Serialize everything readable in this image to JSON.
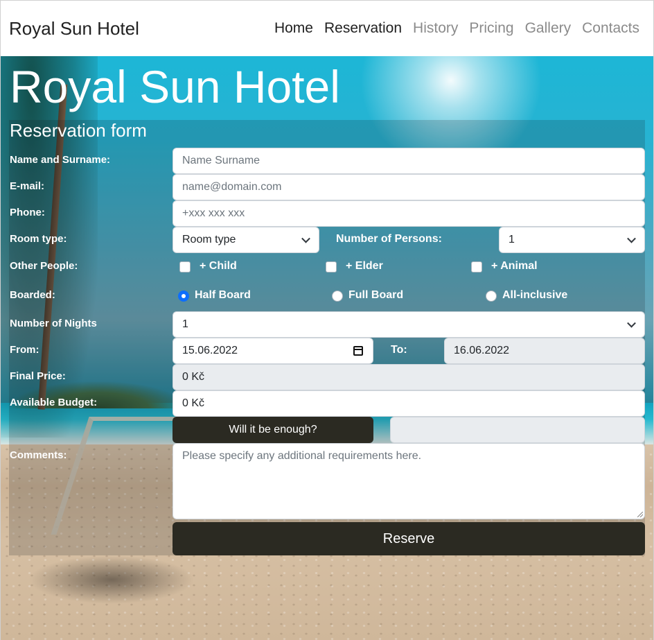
{
  "navbar": {
    "brand": "Royal Sun Hotel",
    "links": [
      {
        "label": "Home",
        "active": true
      },
      {
        "label": "Reservation",
        "active": true
      },
      {
        "label": "History",
        "active": false
      },
      {
        "label": "Pricing",
        "active": false
      },
      {
        "label": "Gallery",
        "active": false
      },
      {
        "label": "Contacts",
        "active": false
      }
    ]
  },
  "hero": {
    "title": "Royal Sun Hotel"
  },
  "form": {
    "title": "Reservation form",
    "name": {
      "label": "Name and Surname:",
      "placeholder": "Name Surname"
    },
    "email": {
      "label": "E-mail:",
      "placeholder": "name@domain.com"
    },
    "phone": {
      "label": "Phone:",
      "placeholder": "+xxx xxx xxx"
    },
    "room_type": {
      "label": "Room type:",
      "value": "Room type"
    },
    "persons": {
      "label": "Number of Persons:",
      "value": "1"
    },
    "other_people": {
      "label": "Other People:",
      "options": [
        {
          "label": "+ Child",
          "checked": false
        },
        {
          "label": "+ Elder",
          "checked": false
        },
        {
          "label": "+ Animal",
          "checked": false
        }
      ]
    },
    "boarded": {
      "label": "Boarded:",
      "options": [
        {
          "label": "Half Board",
          "selected": true
        },
        {
          "label": "Full Board",
          "selected": false
        },
        {
          "label": "All-inclusive",
          "selected": false
        }
      ]
    },
    "nights": {
      "label": "Number of Nights",
      "value": "1"
    },
    "from": {
      "label": "From:",
      "value": "15.06.2022"
    },
    "to": {
      "label": "To:",
      "value": "16.06.2022"
    },
    "final_price": {
      "label": "Final Price:",
      "value": "0 Kč"
    },
    "budget": {
      "label": "Available Budget:",
      "value": "0 Kč"
    },
    "enough_button": "Will it be enough?",
    "enough_result": "",
    "comments": {
      "label": "Comments:",
      "placeholder": "Please specify any additional requirements here."
    },
    "submit": "Reserve"
  },
  "colors": {
    "accent": "#0d6efd",
    "dark_button": "#2b2a22",
    "nav_active": "#212121",
    "nav_inactive": "#8b8b8b"
  }
}
